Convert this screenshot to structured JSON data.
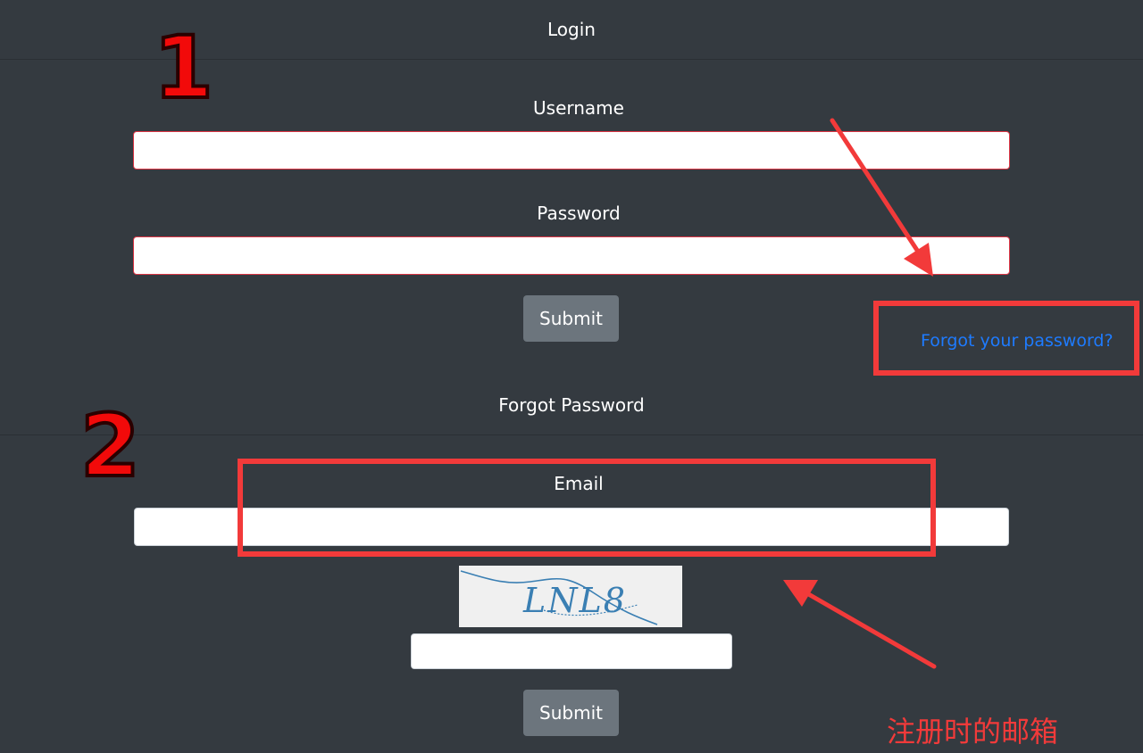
{
  "login": {
    "title": "Login",
    "username_label": "Username",
    "password_label": "Password",
    "submit_label": "Submit",
    "forgot_link": "Forgot your password?"
  },
  "forgot": {
    "title": "Forgot Password",
    "email_label": "Email",
    "captcha_text": "LNL8",
    "submit_label": "Submit"
  },
  "annotations": {
    "step1": "1",
    "step2": "2",
    "note": "注册时的邮箱",
    "color": "#f23a3a"
  },
  "colors": {
    "background": "#343a40",
    "button": "#6c757d",
    "link": "#1e7bff",
    "invalid_border": "#dc3545"
  }
}
